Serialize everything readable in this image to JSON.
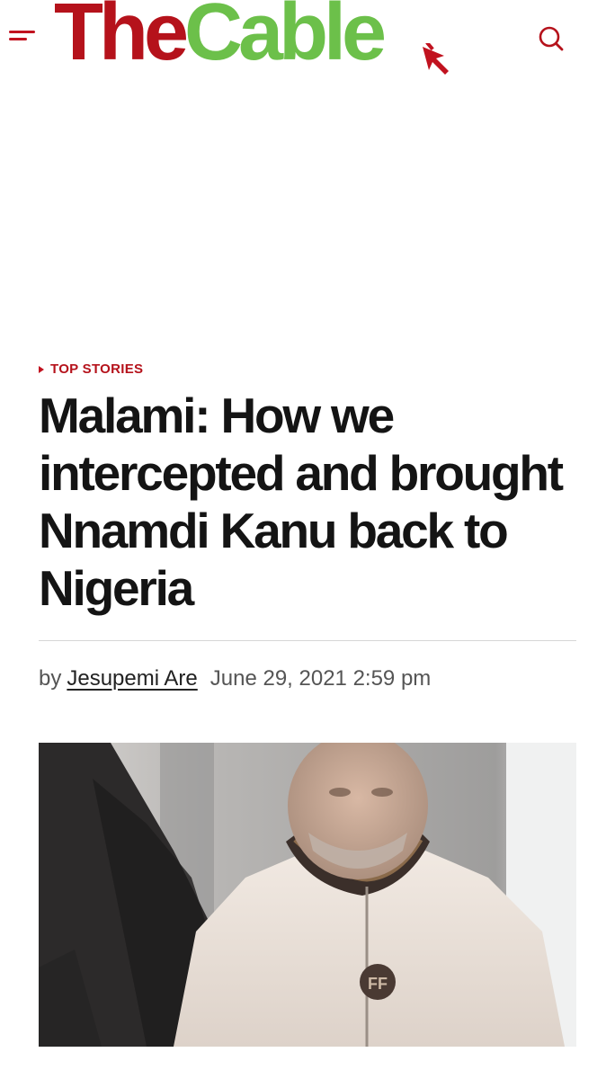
{
  "header": {
    "logo_the": "The",
    "logo_cable": "Cable",
    "menu_icon": "hamburger-menu-icon",
    "search_icon": "search-icon"
  },
  "article": {
    "category": "TOP STORIES",
    "headline": "Malami: How we intercepted and brought Nnamdi Kanu back to Nigeria",
    "by_label": "by",
    "author": "Jesupemi Are",
    "date": "June 29, 2021 2:59 pm"
  },
  "colors": {
    "brand_red": "#b5121b",
    "brand_green": "#6cc04a",
    "text": "#141414",
    "muted": "#555555"
  }
}
